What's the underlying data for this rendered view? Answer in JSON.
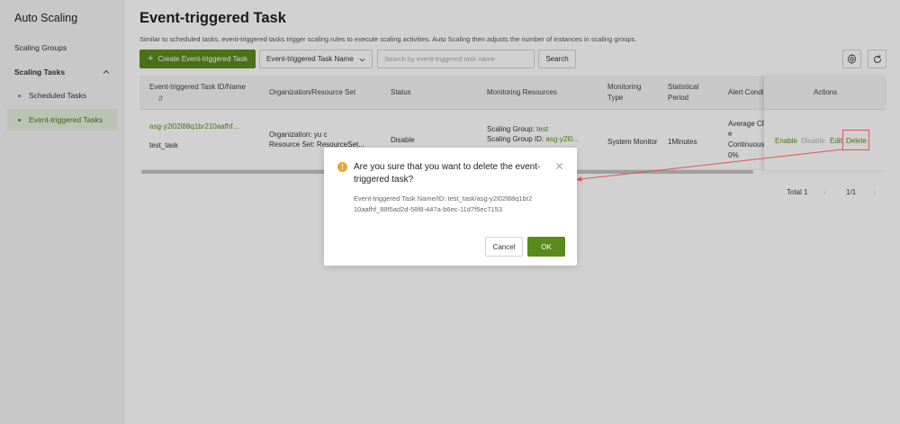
{
  "sidebar": {
    "title": "Auto Scaling",
    "items": [
      {
        "label": "Scaling Groups"
      },
      {
        "label": "Scaling Tasks"
      },
      {
        "label": "Scheduled Tasks"
      },
      {
        "label": "Event-triggered Tasks"
      }
    ]
  },
  "main": {
    "title": "Event-triggered Task",
    "description": "Similar to scheduled tasks, event-triggered tasks trigger scaling rules to execute scaling activities. Auto Scaling then adjusts the number of instances in scaling groups."
  },
  "toolbar": {
    "create_label": "Create Event-triggered Task",
    "create_icon": "+",
    "select_value": "Event-triggered Task Name",
    "search_placeholder": "Search by event-triggered task name",
    "search_label": "Search",
    "settings_icon": "gear-icon",
    "refresh_icon": "refresh-icon"
  },
  "table": {
    "columns": [
      "Event-triggered Task ID/Name",
      "Organization/Resource Set",
      "Status",
      "Monitoring Resources",
      "Monitoring Type",
      "Statistical Period",
      "Alert Condi",
      "Actions"
    ],
    "sort_icon": "⇵",
    "rows": [
      {
        "id": "asg-y2l02l88q1br210aafhf...",
        "name": "test_task",
        "org": "Organization: yu c",
        "resource_set": "Resource Set: ResourceSet...",
        "status": "Disable",
        "group_label": "Scaling Group: ",
        "group_value": "test",
        "group_id_label": "Scaling Group ID: ",
        "group_id_value": "asg-y2l0...",
        "monitoring_type": "System Monitor",
        "period": "1Minutes",
        "alert_lines": [
          "Average CP",
          "e",
          "Continuous",
          "0%"
        ],
        "actions": {
          "enable": "Enable",
          "disable": "Disable",
          "edit": "Edit",
          "delete": "Delete"
        }
      }
    ]
  },
  "pagination": {
    "total": "Total 1",
    "prev": "‹",
    "page": "1/1",
    "next": "›"
  },
  "dialog": {
    "title": "Are you sure that you want to delete the event-triggered task?",
    "icon": "!",
    "close": "×",
    "body": "Event-triggered Task Name/ID: test_task/asg-y2l02l88q1br210aafhf_88f5ad2d-58f8-447a-b6ec-11d7f5ec7153",
    "cancel_label": "Cancel",
    "ok_label": "OK"
  },
  "colors": {
    "brand": "#5b8a1c",
    "warning": "#f0a32e",
    "annotation": "#e05454"
  }
}
